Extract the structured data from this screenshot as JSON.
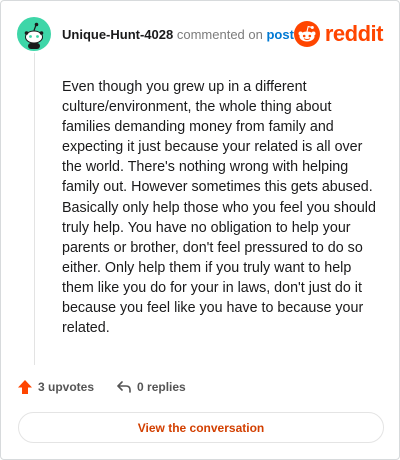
{
  "comment": {
    "username": "Unique-Hunt-4028",
    "action_text": "commented on",
    "post_link": "post",
    "body": "Even though you grew up in a different culture/environment, the whole thing about families demanding money from family and expecting it just because your related is all over the world. There's nothing wrong with helping family out. However sometimes this gets abused. Basically only help those who you feel you should truly help. You have no obligation to help your parents or brother, don't feel pressured to do so either. Only help them if you truly want to help them like you do for your in laws, don't just do it because you feel like you have to because your related."
  },
  "brand": {
    "name": "reddit",
    "color": "#ff4500",
    "icon": "reddit-logo-icon"
  },
  "actions": {
    "upvotes": "3 upvotes",
    "replies": "0 replies",
    "upvote_icon": "upvote-arrow-icon",
    "reply_icon": "reply-arrow-icon"
  },
  "button": {
    "label": "View the conversation"
  },
  "colors": {
    "avatar_bg": "#3ed6a8",
    "accent": "#ff4500",
    "link": "#0079d3",
    "button_text": "#d23f00"
  }
}
